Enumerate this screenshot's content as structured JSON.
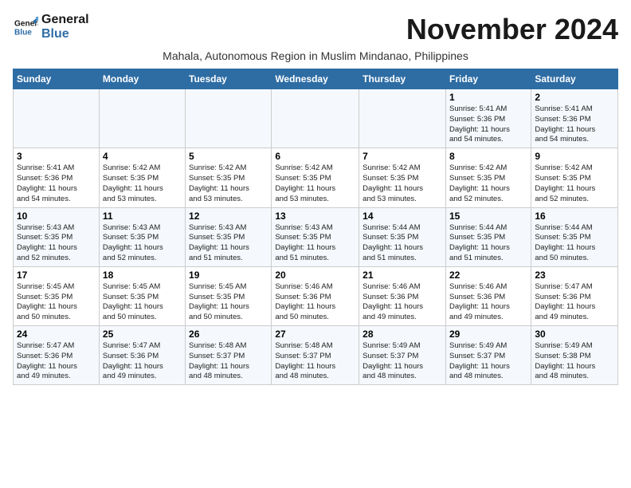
{
  "logo": {
    "line1": "General",
    "line2": "Blue"
  },
  "title": "November 2024",
  "subtitle": "Mahala, Autonomous Region in Muslim Mindanao, Philippines",
  "days_of_week": [
    "Sunday",
    "Monday",
    "Tuesday",
    "Wednesday",
    "Thursday",
    "Friday",
    "Saturday"
  ],
  "weeks": [
    [
      {
        "day": "",
        "info": ""
      },
      {
        "day": "",
        "info": ""
      },
      {
        "day": "",
        "info": ""
      },
      {
        "day": "",
        "info": ""
      },
      {
        "day": "",
        "info": ""
      },
      {
        "day": "1",
        "info": "Sunrise: 5:41 AM\nSunset: 5:36 PM\nDaylight: 11 hours\nand 54 minutes."
      },
      {
        "day": "2",
        "info": "Sunrise: 5:41 AM\nSunset: 5:36 PM\nDaylight: 11 hours\nand 54 minutes."
      }
    ],
    [
      {
        "day": "3",
        "info": "Sunrise: 5:41 AM\nSunset: 5:36 PM\nDaylight: 11 hours\nand 54 minutes."
      },
      {
        "day": "4",
        "info": "Sunrise: 5:42 AM\nSunset: 5:35 PM\nDaylight: 11 hours\nand 53 minutes."
      },
      {
        "day": "5",
        "info": "Sunrise: 5:42 AM\nSunset: 5:35 PM\nDaylight: 11 hours\nand 53 minutes."
      },
      {
        "day": "6",
        "info": "Sunrise: 5:42 AM\nSunset: 5:35 PM\nDaylight: 11 hours\nand 53 minutes."
      },
      {
        "day": "7",
        "info": "Sunrise: 5:42 AM\nSunset: 5:35 PM\nDaylight: 11 hours\nand 53 minutes."
      },
      {
        "day": "8",
        "info": "Sunrise: 5:42 AM\nSunset: 5:35 PM\nDaylight: 11 hours\nand 52 minutes."
      },
      {
        "day": "9",
        "info": "Sunrise: 5:42 AM\nSunset: 5:35 PM\nDaylight: 11 hours\nand 52 minutes."
      }
    ],
    [
      {
        "day": "10",
        "info": "Sunrise: 5:43 AM\nSunset: 5:35 PM\nDaylight: 11 hours\nand 52 minutes."
      },
      {
        "day": "11",
        "info": "Sunrise: 5:43 AM\nSunset: 5:35 PM\nDaylight: 11 hours\nand 52 minutes."
      },
      {
        "day": "12",
        "info": "Sunrise: 5:43 AM\nSunset: 5:35 PM\nDaylight: 11 hours\nand 51 minutes."
      },
      {
        "day": "13",
        "info": "Sunrise: 5:43 AM\nSunset: 5:35 PM\nDaylight: 11 hours\nand 51 minutes."
      },
      {
        "day": "14",
        "info": "Sunrise: 5:44 AM\nSunset: 5:35 PM\nDaylight: 11 hours\nand 51 minutes."
      },
      {
        "day": "15",
        "info": "Sunrise: 5:44 AM\nSunset: 5:35 PM\nDaylight: 11 hours\nand 51 minutes."
      },
      {
        "day": "16",
        "info": "Sunrise: 5:44 AM\nSunset: 5:35 PM\nDaylight: 11 hours\nand 50 minutes."
      }
    ],
    [
      {
        "day": "17",
        "info": "Sunrise: 5:45 AM\nSunset: 5:35 PM\nDaylight: 11 hours\nand 50 minutes."
      },
      {
        "day": "18",
        "info": "Sunrise: 5:45 AM\nSunset: 5:35 PM\nDaylight: 11 hours\nand 50 minutes."
      },
      {
        "day": "19",
        "info": "Sunrise: 5:45 AM\nSunset: 5:35 PM\nDaylight: 11 hours\nand 50 minutes."
      },
      {
        "day": "20",
        "info": "Sunrise: 5:46 AM\nSunset: 5:36 PM\nDaylight: 11 hours\nand 50 minutes."
      },
      {
        "day": "21",
        "info": "Sunrise: 5:46 AM\nSunset: 5:36 PM\nDaylight: 11 hours\nand 49 minutes."
      },
      {
        "day": "22",
        "info": "Sunrise: 5:46 AM\nSunset: 5:36 PM\nDaylight: 11 hours\nand 49 minutes."
      },
      {
        "day": "23",
        "info": "Sunrise: 5:47 AM\nSunset: 5:36 PM\nDaylight: 11 hours\nand 49 minutes."
      }
    ],
    [
      {
        "day": "24",
        "info": "Sunrise: 5:47 AM\nSunset: 5:36 PM\nDaylight: 11 hours\nand 49 minutes."
      },
      {
        "day": "25",
        "info": "Sunrise: 5:47 AM\nSunset: 5:36 PM\nDaylight: 11 hours\nand 49 minutes."
      },
      {
        "day": "26",
        "info": "Sunrise: 5:48 AM\nSunset: 5:37 PM\nDaylight: 11 hours\nand 48 minutes."
      },
      {
        "day": "27",
        "info": "Sunrise: 5:48 AM\nSunset: 5:37 PM\nDaylight: 11 hours\nand 48 minutes."
      },
      {
        "day": "28",
        "info": "Sunrise: 5:49 AM\nSunset: 5:37 PM\nDaylight: 11 hours\nand 48 minutes."
      },
      {
        "day": "29",
        "info": "Sunrise: 5:49 AM\nSunset: 5:37 PM\nDaylight: 11 hours\nand 48 minutes."
      },
      {
        "day": "30",
        "info": "Sunrise: 5:49 AM\nSunset: 5:38 PM\nDaylight: 11 hours\nand 48 minutes."
      }
    ]
  ]
}
